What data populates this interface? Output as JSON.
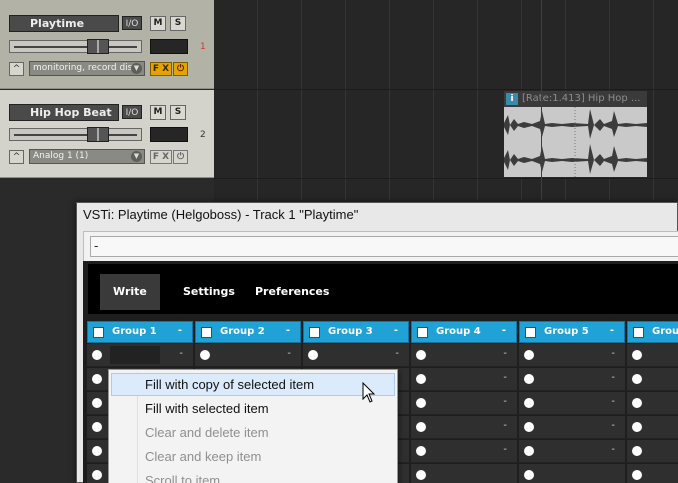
{
  "tracks": [
    {
      "name": "Playtime",
      "io_label": "I/O",
      "mute_label": "M",
      "solo_label": "S",
      "env_symbol": "^",
      "input": "monitoring, record disa",
      "fx_label": "F X",
      "power_symbol": "⏻",
      "number": "1"
    },
    {
      "name": "Hip Hop Beat",
      "io_label": "I/O",
      "mute_label": "M",
      "solo_label": "S",
      "env_symbol": "^",
      "input": "Analog 1 (1)",
      "fx_label": "F X",
      "power_symbol": "⏻",
      "number": "2"
    }
  ],
  "media_item": {
    "icon_label": "i",
    "label": "[Rate:1.413] Hip Hop ..."
  },
  "plugin_window": {
    "title": "VSTi: Playtime (Helgoboss) - Track 1 \"Playtime\"",
    "preset_value": "-",
    "menu": [
      {
        "label": "Write",
        "active": true
      },
      {
        "label": "Settings",
        "active": false
      },
      {
        "label": "Preferences",
        "active": false
      }
    ],
    "groups": [
      {
        "label": "Group 1",
        "dash": "-"
      },
      {
        "label": "Group 2",
        "dash": "-"
      },
      {
        "label": "Group 3",
        "dash": "-"
      },
      {
        "label": "Group 4",
        "dash": "-"
      },
      {
        "label": "Group 5",
        "dash": "-"
      },
      {
        "label": "Grou",
        "dash": ""
      }
    ],
    "cell_dash": "-"
  },
  "context_menu": {
    "items": [
      {
        "label": "Fill with copy of selected item",
        "state": "hover"
      },
      {
        "label": "Fill with selected item",
        "state": "enabled"
      },
      {
        "label": "Clear and delete item",
        "state": "disabled"
      },
      {
        "label": "Clear and keep item",
        "state": "disabled"
      },
      {
        "label": "Scroll to item",
        "state": "disabled"
      }
    ]
  },
  "colors": {
    "group_header": "#21a2d6",
    "record_arm": "#d23a2a",
    "fx_active": "#e5a300"
  },
  "icons": [
    "record-arm-icon",
    "envelope-icon",
    "power-icon",
    "combo-arrow-icon",
    "mouse-cursor-icon",
    "checkbox-icon",
    "radio-icon"
  ]
}
